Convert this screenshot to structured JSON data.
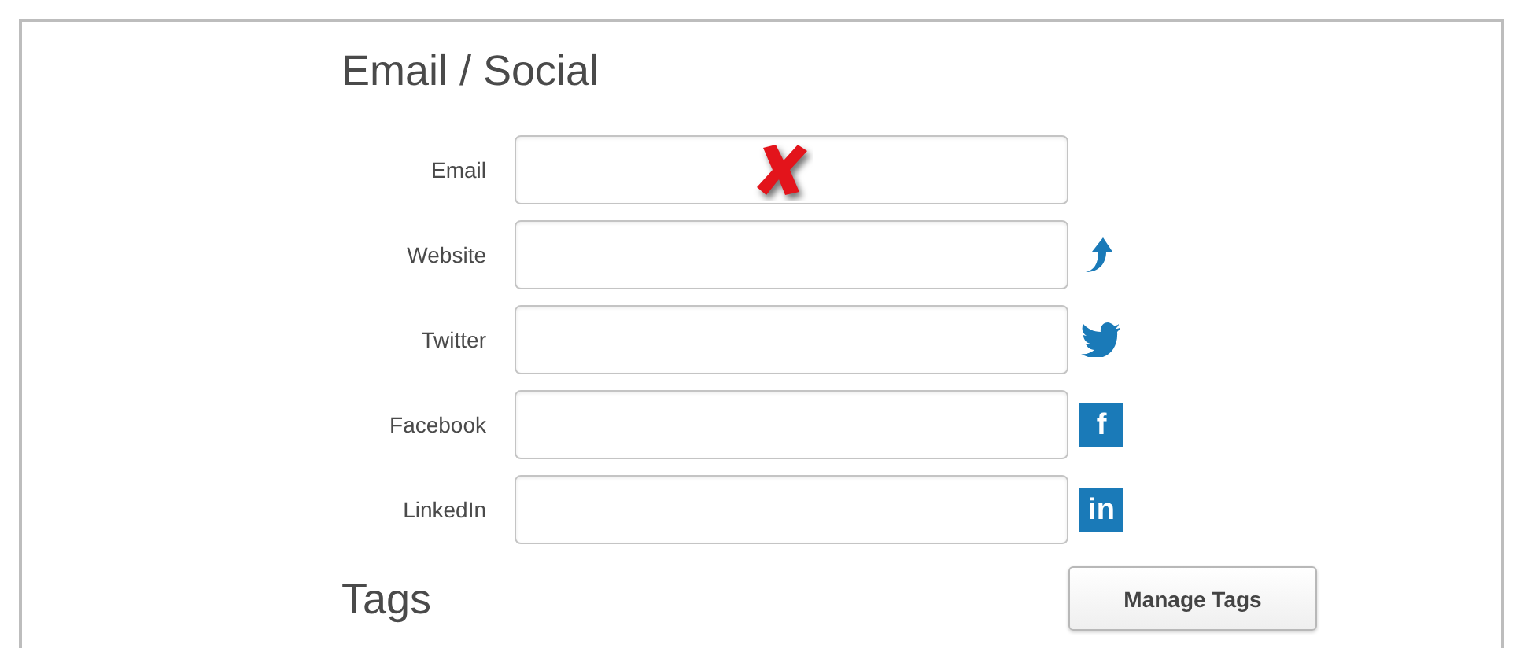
{
  "section_title": "Email / Social",
  "fields": [
    {
      "label": "Email",
      "marked": true
    },
    {
      "label": "Website",
      "marked": false,
      "icon": {
        "kind": "arrow"
      }
    },
    {
      "label": "Twitter",
      "marked": false,
      "icon": {
        "kind": "bird"
      }
    },
    {
      "label": "Facebook",
      "marked": false,
      "icon": {
        "kind": "tile",
        "text": "f"
      }
    },
    {
      "label": "LinkedIn",
      "marked": false,
      "icon": {
        "kind": "tile",
        "text": "in"
      }
    }
  ],
  "tags": {
    "title": "Tags",
    "button": "Manage Tags"
  }
}
